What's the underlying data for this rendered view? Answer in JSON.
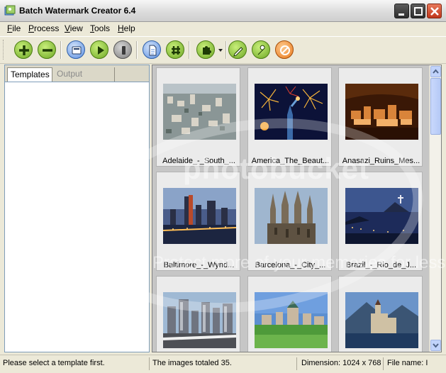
{
  "window": {
    "title": "Batch Watermark Creator 6.4"
  },
  "menu": [
    {
      "key": "F",
      "rest": "ile"
    },
    {
      "key": "P",
      "rest": "rocess"
    },
    {
      "key": "V",
      "rest": "iew"
    },
    {
      "key": "T",
      "rest": "ools"
    },
    {
      "key": "H",
      "rest": "elp"
    }
  ],
  "toolbar": {
    "icons": [
      "add-icon",
      "remove-icon",
      "scan-icon",
      "play-icon",
      "stop-icon",
      "document-icon",
      "hash-icon",
      "puzzle-icon",
      "pencil-icon",
      "wrench-icon",
      "no-entry-icon"
    ],
    "colors": {
      "green": "#8fcb3c",
      "blue": "#5b8fe0",
      "gray": "#8a8a8a",
      "orange": "#f08a2a"
    }
  },
  "tabs": {
    "templates": "Templates",
    "output_settings": "Output Settings"
  },
  "images": [
    {
      "caption": "Adelaide_-_South_...",
      "scene": "city"
    },
    {
      "caption": "America_The_Beaut...",
      "scene": "fireworks"
    },
    {
      "caption": "Anasazi_Ruins_Mes...",
      "scene": "ruins"
    },
    {
      "caption": "Baltimore_-_Wynd...",
      "scene": "harbor"
    },
    {
      "caption": "Barcelona_-_City_...",
      "scene": "cathedral"
    },
    {
      "caption": "Brazil_-_Rio_de_J...",
      "scene": "rio"
    },
    {
      "caption": "",
      "scene": "skyline"
    },
    {
      "caption": "",
      "scene": "town"
    },
    {
      "caption": "",
      "scene": "castle"
    }
  ],
  "watermark": {
    "text": "photobucket",
    "sub": "Protect more of your memories for less!"
  },
  "status": {
    "hint": "Please select a template first.",
    "total": "The images totaled 35.",
    "dimension": "Dimension: 1024 x 768",
    "filename": "File name: I"
  }
}
